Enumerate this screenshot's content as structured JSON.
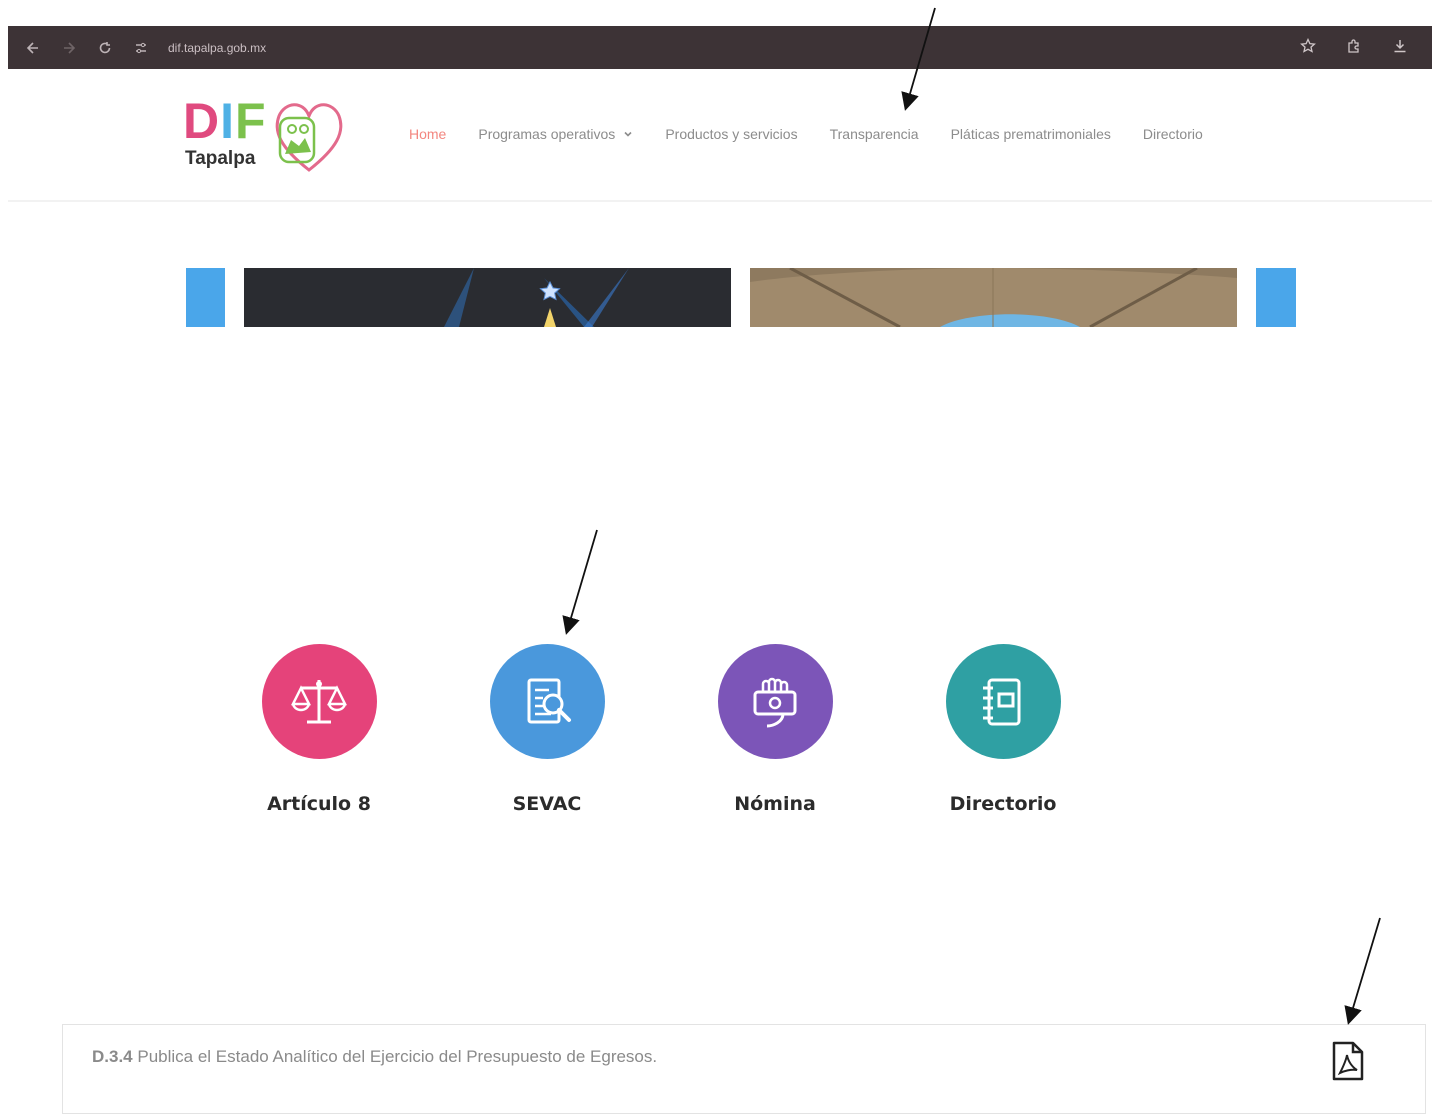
{
  "browser": {
    "url": "dif.tapalpa.gob.mx",
    "icons": [
      "back-icon",
      "forward-icon",
      "reload-icon",
      "site-settings-icon",
      "star-icon",
      "extensions-icon",
      "download-icon"
    ]
  },
  "header": {
    "logo": {
      "letters": [
        "D",
        "I",
        "F"
      ],
      "town": "Tapalpa"
    },
    "nav": [
      {
        "label": "Home",
        "active": true
      },
      {
        "label": "Programas operativos",
        "dropdown": true
      },
      {
        "label": "Productos y servicios"
      },
      {
        "label": "Transparencia"
      },
      {
        "label": "Pláticas prematrimoniales"
      },
      {
        "label": "Directorio"
      }
    ]
  },
  "tiles": [
    {
      "label": "Artículo 8",
      "color": "#e5437a",
      "icon": "balance-scale-icon"
    },
    {
      "label": "SEVAC",
      "color": "#4a98dc",
      "icon": "document-search-icon"
    },
    {
      "label": "Nómina",
      "color": "#7c55b8",
      "icon": "hand-money-icon"
    },
    {
      "label": "Directorio",
      "color": "#2fa0a3",
      "icon": "address-book-icon"
    }
  ],
  "document": {
    "code": "D.3.4",
    "text": " Publica el Estado Analítico del Ejercicio del Presupuesto de Egresos.",
    "icon": "pdf-file-icon"
  },
  "colors": {
    "browser_bar": "#3d3336",
    "nav_active": "#f3867f",
    "nav_text": "#8c8c8c",
    "slide_blue": "#4aa6ea"
  }
}
